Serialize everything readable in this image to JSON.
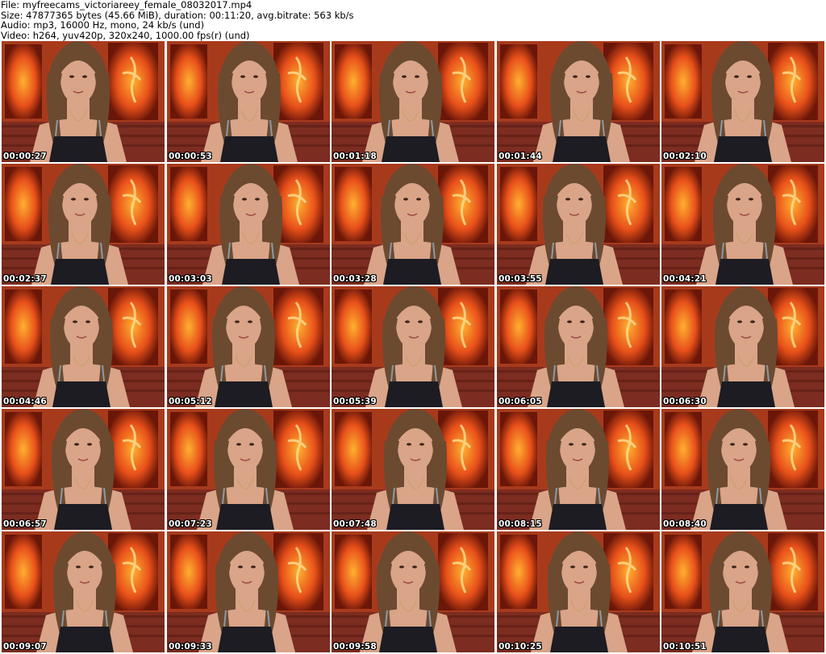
{
  "header": {
    "file_line": "File: myfreecams_victoriareey_female_08032017.mp4",
    "size_line": "Size: 47877365 bytes (45.66 MiB), duration: 00:11:20, avg.bitrate: 563 kb/s",
    "audio_line": "Audio: mp3, 16000 Hz, mono, 24 kb/s (und)",
    "video_line": "Video: h264, yuv420p, 320x240, 1000.00 fps(r) (und)"
  },
  "thumbnails": [
    {
      "timestamp": "00:00:27"
    },
    {
      "timestamp": "00:00:53"
    },
    {
      "timestamp": "00:01:18"
    },
    {
      "timestamp": "00:01:44"
    },
    {
      "timestamp": "00:02:10"
    },
    {
      "timestamp": "00:02:37"
    },
    {
      "timestamp": "00:03:03"
    },
    {
      "timestamp": "00:03:28"
    },
    {
      "timestamp": "00:03:55"
    },
    {
      "timestamp": "00:04:21"
    },
    {
      "timestamp": "00:04:46"
    },
    {
      "timestamp": "00:05:12"
    },
    {
      "timestamp": "00:05:39"
    },
    {
      "timestamp": "00:06:05"
    },
    {
      "timestamp": "00:06:30"
    },
    {
      "timestamp": "00:06:57"
    },
    {
      "timestamp": "00:07:23"
    },
    {
      "timestamp": "00:07:48"
    },
    {
      "timestamp": "00:08:15"
    },
    {
      "timestamp": "00:08:40"
    },
    {
      "timestamp": "00:09:07"
    },
    {
      "timestamp": "00:09:33"
    },
    {
      "timestamp": "00:09:58"
    },
    {
      "timestamp": "00:10:25"
    },
    {
      "timestamp": "00:10:51"
    }
  ],
  "colors": {
    "background": "#ffffff",
    "flame": "#e8501a",
    "flame_bright": "#ffb030",
    "wall": "#8a3020",
    "skin": "#d9a488",
    "hair": "#6b4a30",
    "top": "#1c1c22"
  }
}
